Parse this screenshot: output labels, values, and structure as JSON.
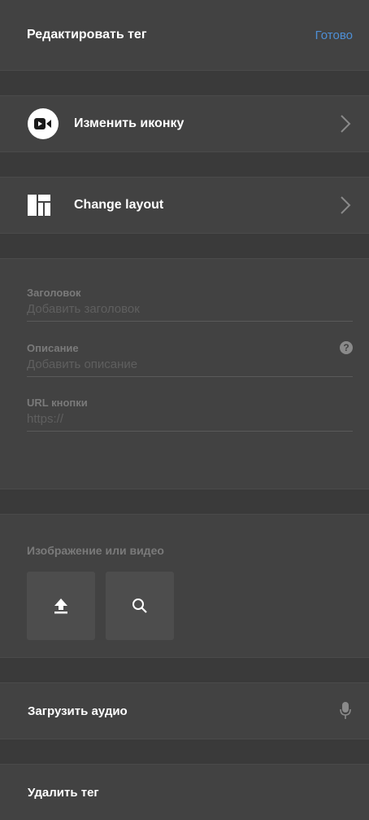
{
  "header": {
    "title": "Редактировать тег",
    "done_label": "Готово"
  },
  "rows": {
    "change_icon": {
      "label": "Изменить иконку",
      "icon": "video-camera-icon"
    },
    "change_layout": {
      "label": "Change layout",
      "icon": "layout-icon"
    }
  },
  "form": {
    "title": {
      "label": "Заголовок",
      "placeholder": "Добавить заголовок"
    },
    "description": {
      "label": "Описание",
      "placeholder": "Добавить описание",
      "help": "?"
    },
    "url": {
      "label": "URL кнопки",
      "placeholder": "https://"
    }
  },
  "media": {
    "label": "Изображение или видео",
    "upload_icon": "upload-icon",
    "search_icon": "search-icon"
  },
  "audio": {
    "label": "Загрузить аудио",
    "icon": "microphone-icon"
  },
  "delete": {
    "label": "Удалить тег"
  },
  "colors": {
    "accent": "#4e8fd6",
    "panel": "#424242",
    "background": "#3a3a3a"
  }
}
